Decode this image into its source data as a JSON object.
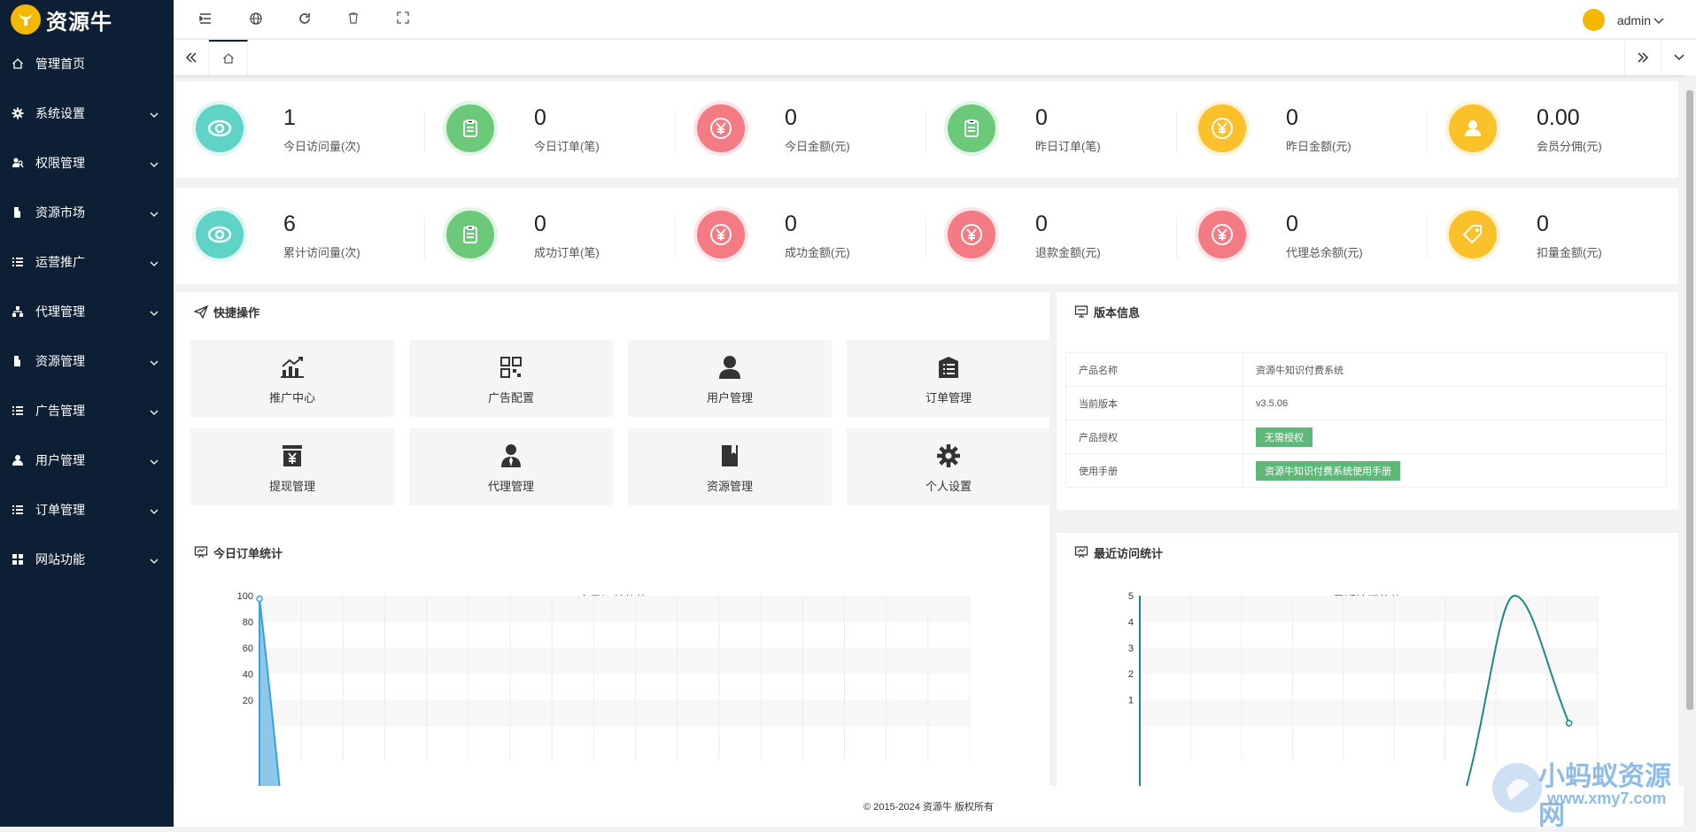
{
  "brand": {
    "name": "资源牛",
    "accent": "#f5b800",
    "sidebar_bg": "#0c1f35"
  },
  "sidebar": {
    "items": [
      {
        "label": "管理首页",
        "icon": "home-icon"
      },
      {
        "label": "系统设置",
        "icon": "gear-icon"
      },
      {
        "label": "权限管理",
        "icon": "users-icon"
      },
      {
        "label": "资源市场",
        "icon": "book-icon"
      },
      {
        "label": "运营推广",
        "icon": "list-icon"
      },
      {
        "label": "代理管理",
        "icon": "sitemap-icon"
      },
      {
        "label": "资源管理",
        "icon": "book-icon"
      },
      {
        "label": "广告管理",
        "icon": "list-icon"
      },
      {
        "label": "用户管理",
        "icon": "user-icon"
      },
      {
        "label": "订单管理",
        "icon": "list-icon"
      },
      {
        "label": "网站功能",
        "icon": "grid-icon"
      }
    ]
  },
  "topbar": {
    "user": "admin"
  },
  "stats_row1": [
    {
      "value": "1",
      "label": "今日访问量(次)",
      "color": "#5fd3c5",
      "icon": "eye-icon"
    },
    {
      "value": "0",
      "label": "今日订单(笔)",
      "color": "#6cc97a",
      "icon": "clipboard-icon"
    },
    {
      "value": "0",
      "label": "今日金额(元)",
      "color": "#f47a84",
      "icon": "yen-icon"
    },
    {
      "value": "0",
      "label": "昨日订单(笔)",
      "color": "#6cc97a",
      "icon": "clipboard-icon"
    },
    {
      "value": "0",
      "label": "昨日金额(元)",
      "color": "#fac12b",
      "icon": "yen-icon"
    },
    {
      "value": "0.00",
      "label": "会员分佣(元)",
      "color": "#fac12b",
      "icon": "user-icon"
    }
  ],
  "stats_row2": [
    {
      "value": "6",
      "label": "累计访问量(次)",
      "color": "#5fd3c5",
      "icon": "eye-icon"
    },
    {
      "value": "0",
      "label": "成功订单(笔)",
      "color": "#6cc97a",
      "icon": "clipboard-icon"
    },
    {
      "value": "0",
      "label": "成功金额(元)",
      "color": "#f47a84",
      "icon": "yen-icon"
    },
    {
      "value": "0",
      "label": "退款金额(元)",
      "color": "#f47a84",
      "icon": "yen-icon"
    },
    {
      "value": "0",
      "label": "代理总余额(元)",
      "color": "#f47a84",
      "icon": "yen-icon"
    },
    {
      "value": "0",
      "label": "扣量金额(元)",
      "color": "#fac12b",
      "icon": "tag-icon"
    }
  ],
  "quick": {
    "title": "快捷操作",
    "items": [
      {
        "label": "推广中心",
        "icon": "chart-up-icon"
      },
      {
        "label": "广告配置",
        "icon": "qrcode-icon"
      },
      {
        "label": "用户管理",
        "icon": "user-icon"
      },
      {
        "label": "订单管理",
        "icon": "list-box-icon"
      },
      {
        "label": "提现管理",
        "icon": "yen-box-icon"
      },
      {
        "label": "代理管理",
        "icon": "agent-icon"
      },
      {
        "label": "资源管理",
        "icon": "book-icon"
      },
      {
        "label": "个人设置",
        "icon": "gear-icon"
      }
    ]
  },
  "version": {
    "title": "版本信息",
    "rows": [
      {
        "key": "产品名称",
        "value": "资源牛知识付费系统"
      },
      {
        "key": "当前版本",
        "value": "v3.5.06"
      },
      {
        "key": "产品授权",
        "value": "无需授权"
      },
      {
        "key": "使用手册",
        "value": "资源牛知识付费系统使用手册"
      }
    ]
  },
  "orders_panel": {
    "title": "今日订单统计"
  },
  "visits_panel": {
    "title": "最近访问统计"
  },
  "chart_data": [
    {
      "type": "area",
      "title": "今日订单趋势",
      "yticks": [
        "100",
        "80",
        "60",
        "40",
        "20"
      ],
      "ylim": [
        0,
        100
      ],
      "categories": 24,
      "values": [
        98,
        0
      ],
      "color": "#3ea0d8"
    },
    {
      "type": "line",
      "title": "最近访问趋势",
      "yticks": [
        "5",
        "4",
        "3",
        "2",
        "1"
      ],
      "ylim": [
        0,
        5
      ],
      "values": [
        0,
        0,
        0,
        0,
        0,
        0,
        5,
        1
      ],
      "color": "#1a8a82"
    }
  ],
  "footer": "© 2015-2024 资源牛 版权所有",
  "watermark": {
    "line1": "小蚂蚁资源网",
    "line2": "www.xmy7.com"
  }
}
